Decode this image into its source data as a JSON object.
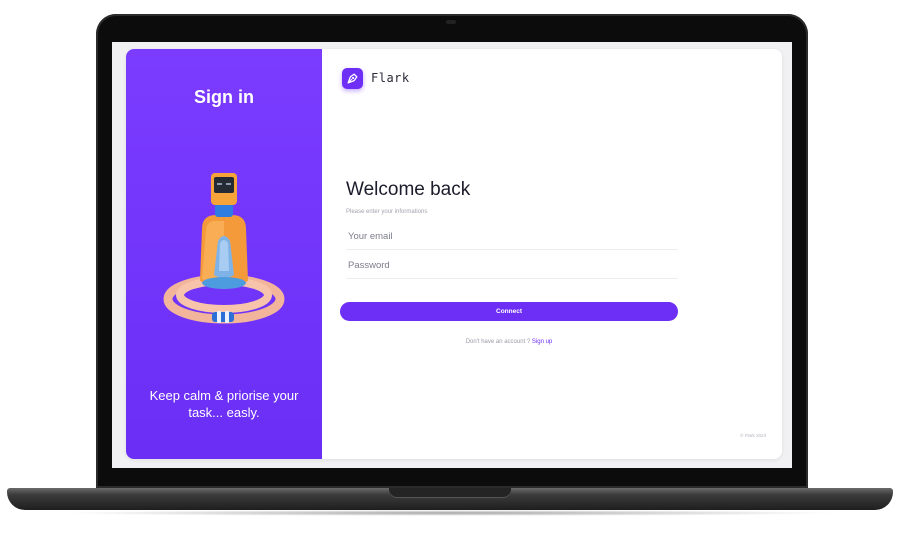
{
  "left_panel": {
    "title": "Sign in",
    "tagline": "Keep calm & priorise your task... easly."
  },
  "brand": {
    "name": "Flark",
    "logo_icon": "pen-nib-icon"
  },
  "form": {
    "heading": "Welcome back",
    "subtitle": "Please enter your informations",
    "email_placeholder": "Your email",
    "password_placeholder": "Password",
    "connect_label": "Connect",
    "no_account_text": "Don't have an account ?",
    "signup_label": "Sign up"
  },
  "footer": {
    "copyright": "© Flark 2023"
  },
  "colors": {
    "accent": "#6d2ef6",
    "panel_gradient_top": "#7b3cff",
    "panel_gradient_bottom": "#6a2ef5"
  }
}
